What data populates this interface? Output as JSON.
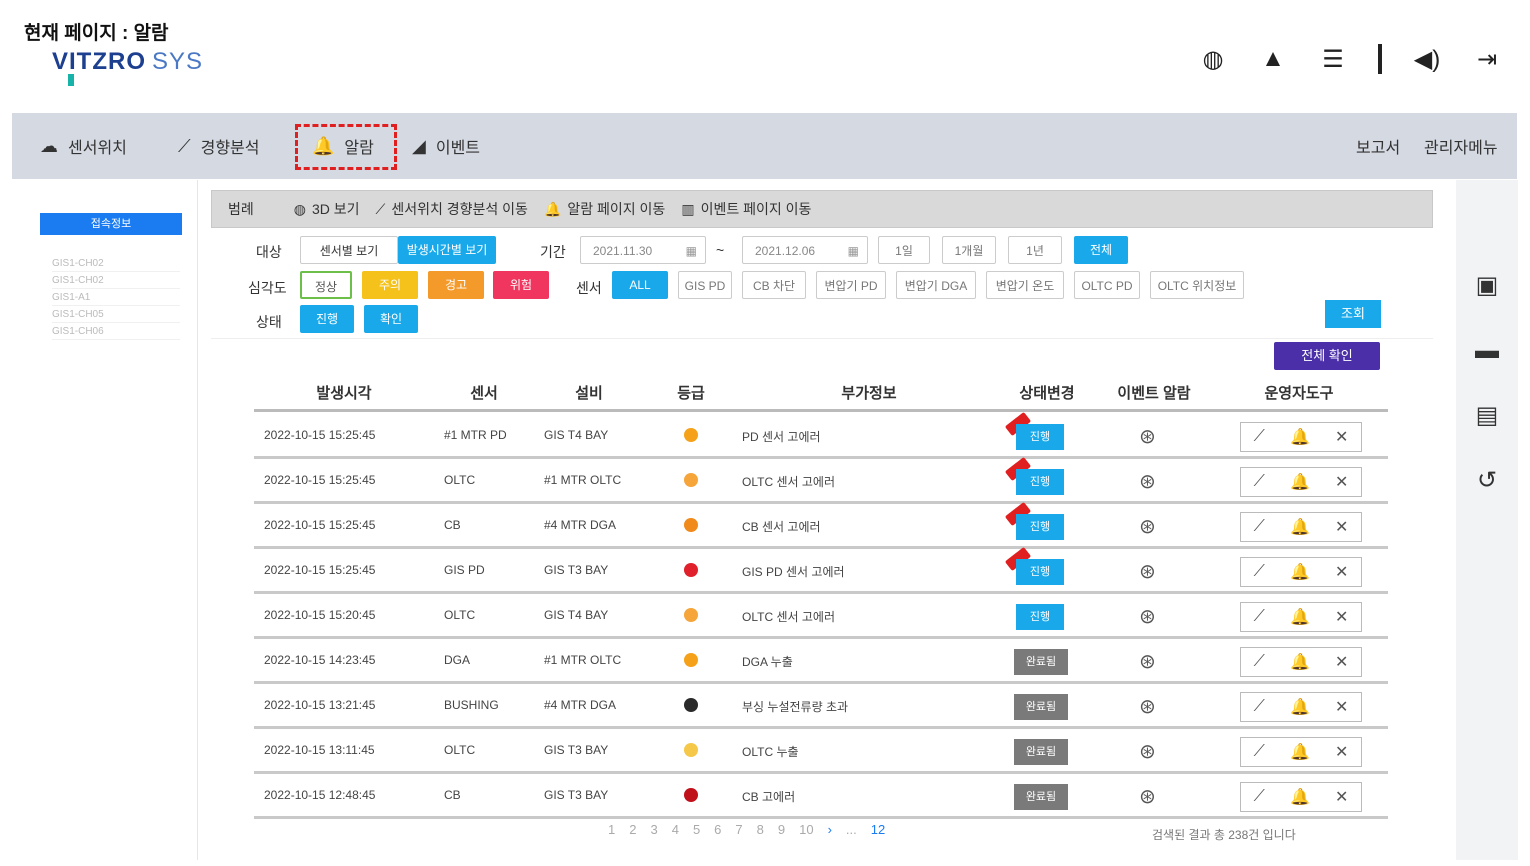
{
  "page_title": "현재 페이지 : 알람",
  "logo": {
    "main": "VITZRO",
    "sub": "SYS"
  },
  "top_icons": [
    "globe-icon",
    "warning-icon",
    "server-icon",
    "divider",
    "speaker-icon",
    "logout-icon"
  ],
  "nav": {
    "items": [
      {
        "label": "센서위치",
        "icon": "☁"
      },
      {
        "label": "경향분석",
        "icon": "⟋"
      },
      {
        "label": "알람",
        "icon": "🔔"
      },
      {
        "label": "이벤트",
        "icon": "◢"
      }
    ],
    "right": [
      "보고서",
      "관리자메뉴"
    ]
  },
  "sidebar": {
    "button": "접속정보",
    "items": [
      "GIS1-CH02",
      "GIS1-CH02",
      "GIS1-A1",
      "GIS1-CH05",
      "GIS1-CH06"
    ]
  },
  "filter_header": {
    "items": [
      {
        "icon": "▤",
        "label": "범례"
      },
      {
        "icon": "◍",
        "label": "3D 보기"
      },
      {
        "icon": "⟋",
        "label": "센서위치 경향분석 이동"
      },
      {
        "icon": "🔔",
        "label": "알람 페이지 이동"
      },
      {
        "icon": "▥",
        "label": "이벤트 페이지 이동"
      }
    ]
  },
  "filters": {
    "target_label": "대상",
    "target_options": [
      "센서별 보기",
      "발생시간별 보기"
    ],
    "period_label": "기간",
    "date_from": "2021.11.30",
    "date_to": "2021.12.06",
    "period_options": [
      "1일",
      "1개월",
      "1년",
      "전체"
    ],
    "severity_label": "심각도",
    "severity_options": [
      "정상",
      "주의",
      "경고",
      "위험"
    ],
    "sensor_label": "센서",
    "sensor_options": [
      "ALL",
      "GIS PD",
      "CB 차단",
      "변압기 PD",
      "변압기 DGA",
      "변압기 온도",
      "OLTC PD",
      "OLTC 위치정보"
    ],
    "state_label": "상태",
    "state_options": [
      "진행",
      "확인"
    ],
    "search_button": "조회",
    "bulk_button": "전체 확인"
  },
  "table": {
    "headers": [
      "발생시각",
      "센서",
      "설비",
      "등급",
      "부가정보",
      "상태변경",
      "이벤트 알람",
      "운영자도구"
    ],
    "rows": [
      {
        "time": "2022-10-15 15:25:45",
        "sensor": "#1 MTR PD",
        "equip": "GIS T4 BAY",
        "grade_color": "#f5a21a",
        "info": "PD 센서 고에러",
        "state": "진행",
        "flag": true
      },
      {
        "time": "2022-10-15 15:25:45",
        "sensor": "OLTC",
        "equip": "#1 MTR OLTC",
        "grade_color": "#f5a53a",
        "info": "OLTC 센서 고에러",
        "state": "진행",
        "flag": true
      },
      {
        "time": "2022-10-15 15:25:45",
        "sensor": "CB",
        "equip": "#4 MTR DGA",
        "grade_color": "#f08a1a",
        "info": "CB 센서 고에러",
        "state": "진행",
        "flag": true
      },
      {
        "time": "2022-10-15 15:25:45",
        "sensor": "GIS PD",
        "equip": "GIS T3 BAY",
        "grade_color": "#e0202a",
        "info": "GIS PD 센서 고에러",
        "state": "진행",
        "flag": true
      },
      {
        "time": "2022-10-15 15:20:45",
        "sensor": "OLTC",
        "equip": "GIS T4 BAY",
        "grade_color": "#f5a53a",
        "info": "OLTC 센서 고에러",
        "state": "진행",
        "flag": false
      },
      {
        "time": "2022-10-15 14:23:45",
        "sensor": "DGA",
        "equip": "#1 MTR OLTC",
        "grade_color": "#f5a21a",
        "info": "DGA 누출",
        "state": "완료됨",
        "flag": false
      },
      {
        "time": "2022-10-15 13:21:45",
        "sensor": "BUSHING",
        "equip": "#4 MTR DGA",
        "grade_color": "#2a2a2a",
        "info": "부싱 누설전류량 초과",
        "state": "완료됨",
        "flag": false
      },
      {
        "time": "2022-10-15 13:11:45",
        "sensor": "OLTC",
        "equip": "GIS T3 BAY",
        "grade_color": "#f5c84a",
        "info": "OLTC 누출",
        "state": "완료됨",
        "flag": false
      },
      {
        "time": "2022-10-15 12:48:45",
        "sensor": "CB",
        "equip": "GIS T3 BAY",
        "grade_color": "#c0101a",
        "info": "CB 고에러",
        "state": "완료됨",
        "flag": false
      }
    ]
  },
  "pagination": {
    "pages": [
      "1",
      "2",
      "3",
      "4",
      "5",
      "6",
      "7",
      "8",
      "9",
      "10",
      "›",
      "...",
      "12"
    ],
    "current": "1"
  },
  "result_text": "검색된 결과 총 238건 입니다"
}
